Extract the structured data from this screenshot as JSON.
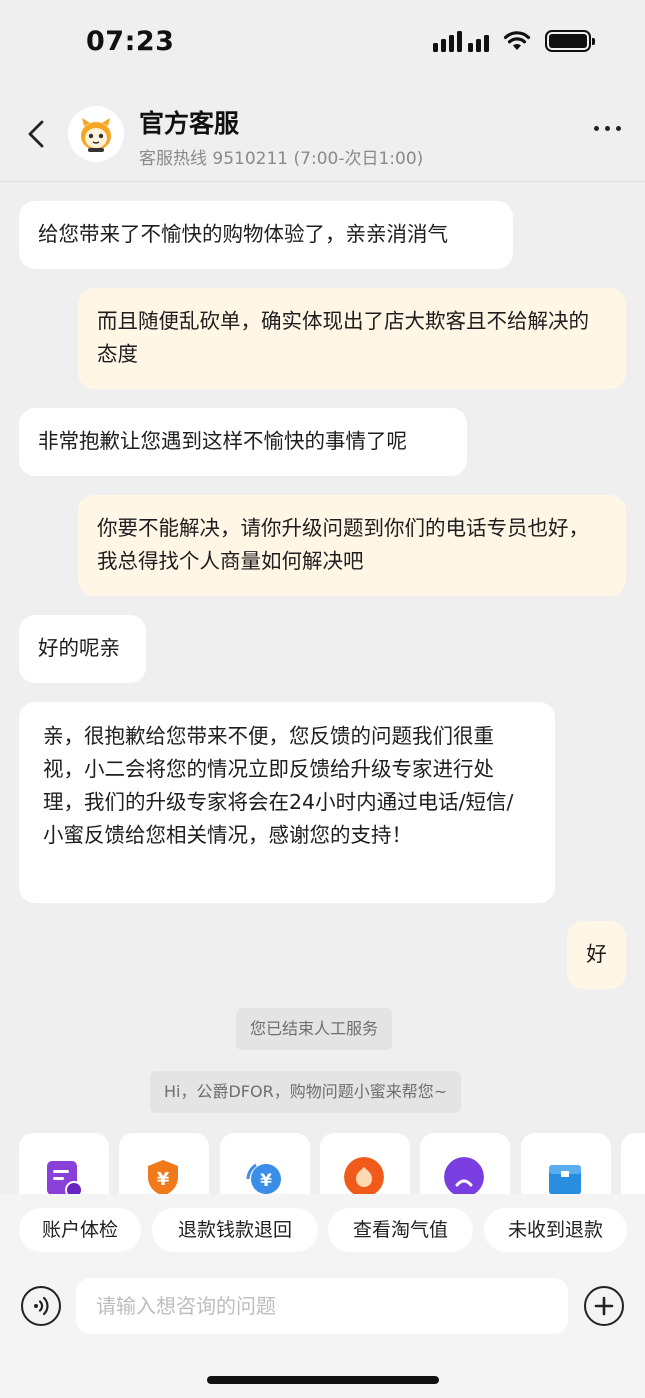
{
  "status_bar": {
    "time": "07:23"
  },
  "header": {
    "title": "官方客服",
    "subtitle": "客服热线 9510211 (7:00-次日1:00)"
  },
  "messages": [
    {
      "side": "left",
      "text": "给您带来了不愉快的购物体验了，亲亲消消气"
    },
    {
      "side": "right",
      "text": "而且随便乱砍单，确实体现出了店大欺客且不给解决的态度"
    },
    {
      "side": "left",
      "text": "非常抱歉让您遇到这样不愉快的事情了呢"
    },
    {
      "side": "right",
      "text": "你要不能解决，请你升级问题到你们的电话专员也好，我总得找个人商量如何解决吧"
    },
    {
      "side": "left",
      "text": "好的呢亲"
    },
    {
      "side": "left",
      "text": "亲，很抱歉给您带来不便，您反馈的问题我们很重视，小二会将您的情况立即反馈给升级专家进行处理，我们的升级专家将会在24小时内通过电话/短信/小蜜反馈给您相关情况，感谢您的支持！"
    },
    {
      "side": "right",
      "text": "好"
    }
  ],
  "system_messages": [
    "您已结束人工服务",
    "Hi，公爵DFOR，购物问题小蜜来帮您~"
  ],
  "service_cards": [
    {
      "icon": "document-clock-icon",
      "color": "#8a3fd8"
    },
    {
      "icon": "yuan-shield-icon",
      "color": "#f07a1a"
    },
    {
      "icon": "yuan-refresh-icon",
      "color": "#3a8ee8"
    },
    {
      "icon": "flower-icon",
      "color": "#f05a1a"
    },
    {
      "icon": "assistant-face-icon",
      "color": "#7a3ee0"
    },
    {
      "icon": "box-icon",
      "color": "#2a8ee0"
    }
  ],
  "quick_replies": [
    "账户体检",
    "退款钱款退回",
    "查看淘气值",
    "未收到退款"
  ],
  "input": {
    "placeholder": "请输入想咨询的问题"
  }
}
